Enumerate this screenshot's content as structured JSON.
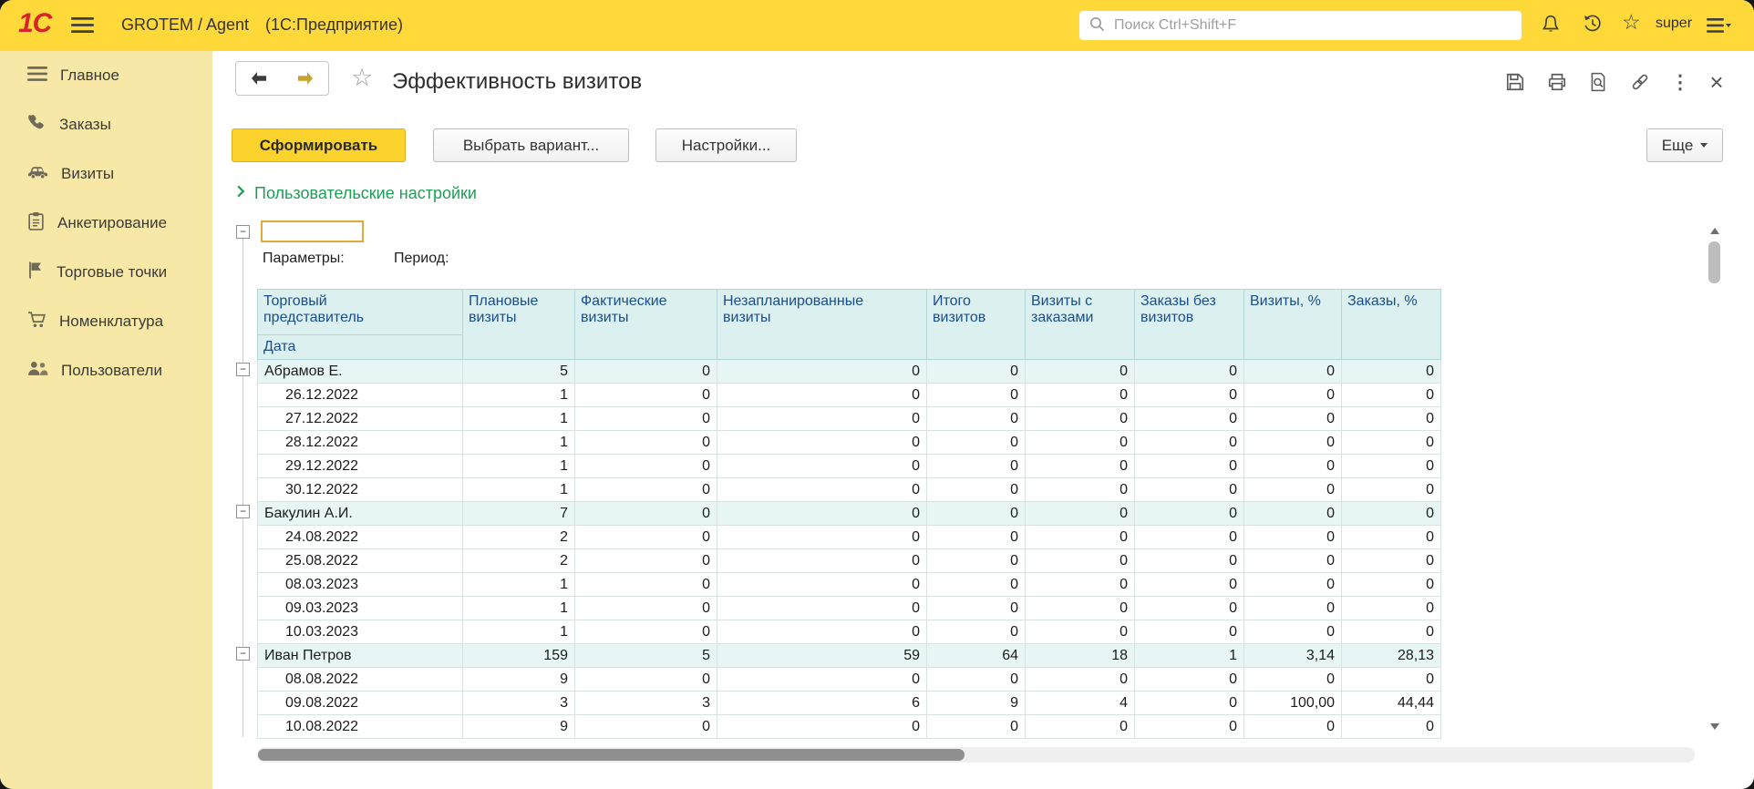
{
  "topbar": {
    "logo": "1С",
    "app_title": "GROTEM / Agent",
    "app_subtitle": "(1С:Предприятие)",
    "search_placeholder": "Поиск Ctrl+Shift+F",
    "user": "super"
  },
  "sidebar": {
    "items": [
      {
        "label": "Главное",
        "icon": "menu-icon"
      },
      {
        "label": "Заказы",
        "icon": "phone-icon"
      },
      {
        "label": "Визиты",
        "icon": "car-icon"
      },
      {
        "label": "Анкетирование",
        "icon": "survey-icon"
      },
      {
        "label": "Торговые точки",
        "icon": "flag-icon"
      },
      {
        "label": "Номенклатура",
        "icon": "cart-icon"
      },
      {
        "label": "Пользователи",
        "icon": "users-icon"
      }
    ]
  },
  "report": {
    "title": "Эффективность визитов",
    "actions": {
      "generate": "Сформировать",
      "select_variant": "Выбрать вариант...",
      "settings": "Настройки...",
      "more": "Еще"
    },
    "user_settings_link": "Пользовательские настройки",
    "params_label": "Параметры:",
    "period_label": "Период:",
    "param_value": ""
  },
  "table": {
    "rep_header": "Торговый представитель",
    "date_header": "Дата",
    "columns": [
      "Плановые визиты",
      "Фактические визиты",
      "Незапланированные визиты",
      "Итого визитов",
      "Визиты с заказами",
      "Заказы без визитов",
      "Визиты, %",
      "Заказы, %"
    ],
    "groups": [
      {
        "name": "Абрамов Е.",
        "totals": [
          "5",
          "0",
          "0",
          "0",
          "0",
          "0",
          "0",
          "0"
        ],
        "rows": [
          {
            "date": "26.12.2022",
            "values": [
              "1",
              "0",
              "0",
              "0",
              "0",
              "0",
              "0",
              "0"
            ]
          },
          {
            "date": "27.12.2022",
            "values": [
              "1",
              "0",
              "0",
              "0",
              "0",
              "0",
              "0",
              "0"
            ]
          },
          {
            "date": "28.12.2022",
            "values": [
              "1",
              "0",
              "0",
              "0",
              "0",
              "0",
              "0",
              "0"
            ]
          },
          {
            "date": "29.12.2022",
            "values": [
              "1",
              "0",
              "0",
              "0",
              "0",
              "0",
              "0",
              "0"
            ]
          },
          {
            "date": "30.12.2022",
            "values": [
              "1",
              "0",
              "0",
              "0",
              "0",
              "0",
              "0",
              "0"
            ]
          }
        ]
      },
      {
        "name": "Бакулин А.И.",
        "totals": [
          "7",
          "0",
          "0",
          "0",
          "0",
          "0",
          "0",
          "0"
        ],
        "rows": [
          {
            "date": "24.08.2022",
            "values": [
              "2",
              "0",
              "0",
              "0",
              "0",
              "0",
              "0",
              "0"
            ]
          },
          {
            "date": "25.08.2022",
            "values": [
              "2",
              "0",
              "0",
              "0",
              "0",
              "0",
              "0",
              "0"
            ]
          },
          {
            "date": "08.03.2023",
            "values": [
              "1",
              "0",
              "0",
              "0",
              "0",
              "0",
              "0",
              "0"
            ]
          },
          {
            "date": "09.03.2023",
            "values": [
              "1",
              "0",
              "0",
              "0",
              "0",
              "0",
              "0",
              "0"
            ]
          },
          {
            "date": "10.03.2023",
            "values": [
              "1",
              "0",
              "0",
              "0",
              "0",
              "0",
              "0",
              "0"
            ]
          }
        ]
      },
      {
        "name": "Иван Петров",
        "totals": [
          "159",
          "5",
          "59",
          "64",
          "18",
          "1",
          "3,14",
          "28,13"
        ],
        "rows": [
          {
            "date": "08.08.2022",
            "values": [
              "9",
              "0",
              "0",
              "0",
              "0",
              "0",
              "0",
              "0"
            ]
          },
          {
            "date": "09.08.2022",
            "values": [
              "3",
              "3",
              "6",
              "9",
              "4",
              "0",
              "100,00",
              "44,44"
            ]
          },
          {
            "date": "10.08.2022",
            "values": [
              "9",
              "0",
              "0",
              "0",
              "0",
              "0",
              "0",
              "0"
            ]
          }
        ]
      }
    ]
  },
  "colors": {
    "topbar_yellow": "#FFD83A",
    "sidebar_yellow": "#F7E8A7",
    "table_header_fill": "#DBF0EF",
    "group_row_fill": "#E7F6F5",
    "table_header_text": "#1A4E8A",
    "link_green": "#1E9E55",
    "generate_button_yellow": "#FCD22C",
    "logo_red": "#D8232A"
  }
}
